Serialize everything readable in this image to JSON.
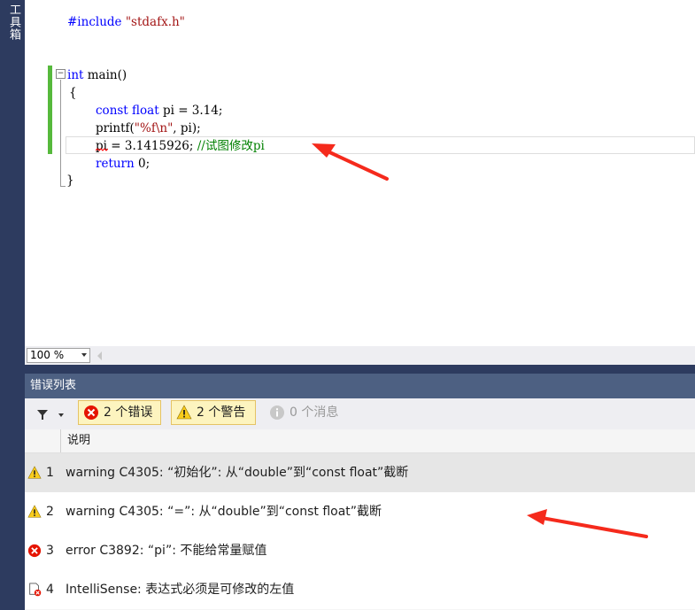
{
  "toolbox": {
    "label": "工具箱"
  },
  "editor": {
    "code": {
      "l1": {
        "directive": "#include",
        "include_path": "\"stdafx.h\""
      },
      "l2": {
        "type": "int",
        "name": "main()"
      },
      "l3": {
        "brace": "{"
      },
      "l4": {
        "kw1": "const",
        "kw2": "float",
        "rest": "pi = 3.14;"
      },
      "l5": {
        "fn": "printf(",
        "fmt": "\"%f\\n\"",
        "rest": ", pi);"
      },
      "l6": {
        "var": "pi",
        "rest": " = 3.1415926; ",
        "comment": "//试图修改pi"
      },
      "l7": {
        "kw": "return",
        "rest": " 0;"
      },
      "l8": {
        "brace": "}"
      }
    },
    "zoom": "100 %"
  },
  "error_list": {
    "title": "错误列表",
    "errors_button": "2 个错误",
    "warnings_button": "2 个警告",
    "messages_button": "0 个消息",
    "column_description": "说明",
    "rows": [
      {
        "num": "1",
        "icon": "warning-icon",
        "desc": "warning C4305: “初始化”: 从“double”到“const float”截断"
      },
      {
        "num": "2",
        "icon": "warning-icon",
        "desc": "warning C4305: “=”: 从“double”到“const float”截断"
      },
      {
        "num": "3",
        "icon": "error-icon",
        "desc": "error C3892: “pi”: 不能给常量赋值"
      },
      {
        "num": "4",
        "icon": "intellisense-error-icon",
        "desc": "IntelliSense:  表达式必须是可修改的左值"
      }
    ]
  },
  "colors": {
    "toolbox": "#2d3b5f",
    "panel_title": "#4d6082",
    "keyword": "#0000ff",
    "string": "#a31515",
    "comment": "#008000",
    "change_bar": "#56b93c",
    "annotation": "#f52a1c"
  }
}
